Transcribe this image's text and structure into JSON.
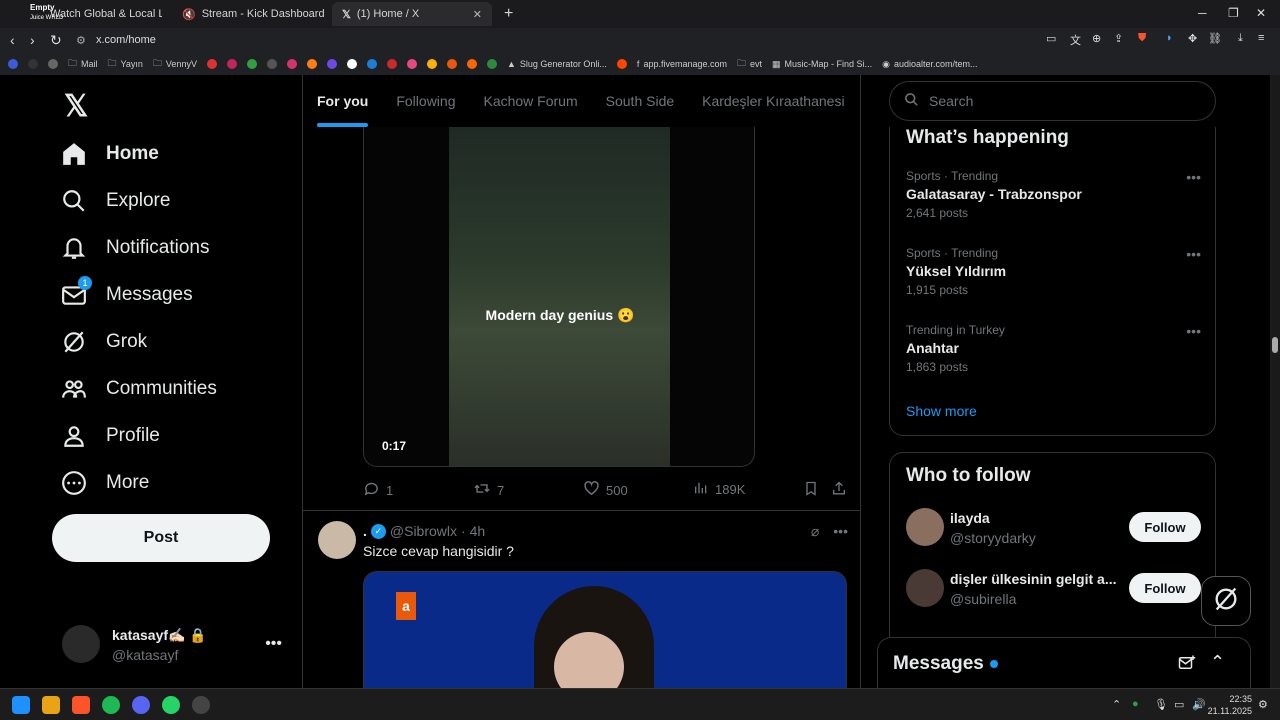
{
  "browser": {
    "tabs": [
      {
        "label": "Watch Global & Local Live TV On"
      },
      {
        "label": "Stream - Kick Dashboard"
      },
      {
        "label": "(1) Home / X"
      }
    ],
    "media_overlay": {
      "title": "Empty",
      "artist": "Juice WRLD"
    },
    "url": "x.com/home",
    "bookmarks": [
      "Mail",
      "Yayın",
      "VennyV",
      "Slug Generator Onli...",
      "app.fivemanage.com",
      "evt",
      "Music-Map - Find Si...",
      "audioalter.com/tem..."
    ]
  },
  "sidebar": {
    "nav": [
      {
        "label": "Home",
        "icon": "home-icon"
      },
      {
        "label": "Explore",
        "icon": "search-icon"
      },
      {
        "label": "Notifications",
        "icon": "bell-icon"
      },
      {
        "label": "Messages",
        "icon": "mail-icon",
        "badge": "1"
      },
      {
        "label": "Grok",
        "icon": "grok-icon"
      },
      {
        "label": "Communities",
        "icon": "communities-icon"
      },
      {
        "label": "Profile",
        "icon": "person-icon"
      },
      {
        "label": "More",
        "icon": "more-circle-icon"
      }
    ],
    "post_label": "Post",
    "account": {
      "name": "katasayf✍🏻",
      "handle": "@katasayf"
    }
  },
  "feed": {
    "tabs": [
      "For you",
      "Following",
      "Kachow Forum",
      "South Side",
      "Kardeşler Kıraathanesi"
    ],
    "video_post": {
      "caption": "Modern day genius 😮",
      "time": "0:17",
      "replies": "1",
      "reposts": "7",
      "likes": "500",
      "views": "189K"
    },
    "post2": {
      "name": ".",
      "handle": "@Sibrowlx",
      "time": "· 4h",
      "text": "Sizce cevap hangisidir ?"
    }
  },
  "right": {
    "search_placeholder": "Search",
    "happening_title": "What’s happening",
    "trends": [
      {
        "meta": "Sports · Trending",
        "name": "Galatasaray - Trabzonspor",
        "count": "2,641 posts"
      },
      {
        "meta": "Sports · Trending",
        "name": "Yüksel Yıldırım",
        "count": "1,915 posts"
      },
      {
        "meta": "Trending in Turkey",
        "name": "Anahtar",
        "count": "1,863 posts"
      }
    ],
    "show_more": "Show more",
    "follow_title": "Who to follow",
    "follow": [
      {
        "name": "ilayda",
        "handle": "@storyydarky",
        "button": "Follow"
      },
      {
        "name": "dişler ülkesinin gelgit a...",
        "handle": "@subirella",
        "button": "Follow"
      }
    ]
  },
  "messages_drawer": {
    "title": "Messages"
  },
  "taskbar": {
    "time": "22:35",
    "date": "21.11.2025"
  },
  "colors": {
    "accent": "#1d9bf0",
    "background": "#000000",
    "text": "#e7e9ea",
    "muted": "#71767b"
  }
}
